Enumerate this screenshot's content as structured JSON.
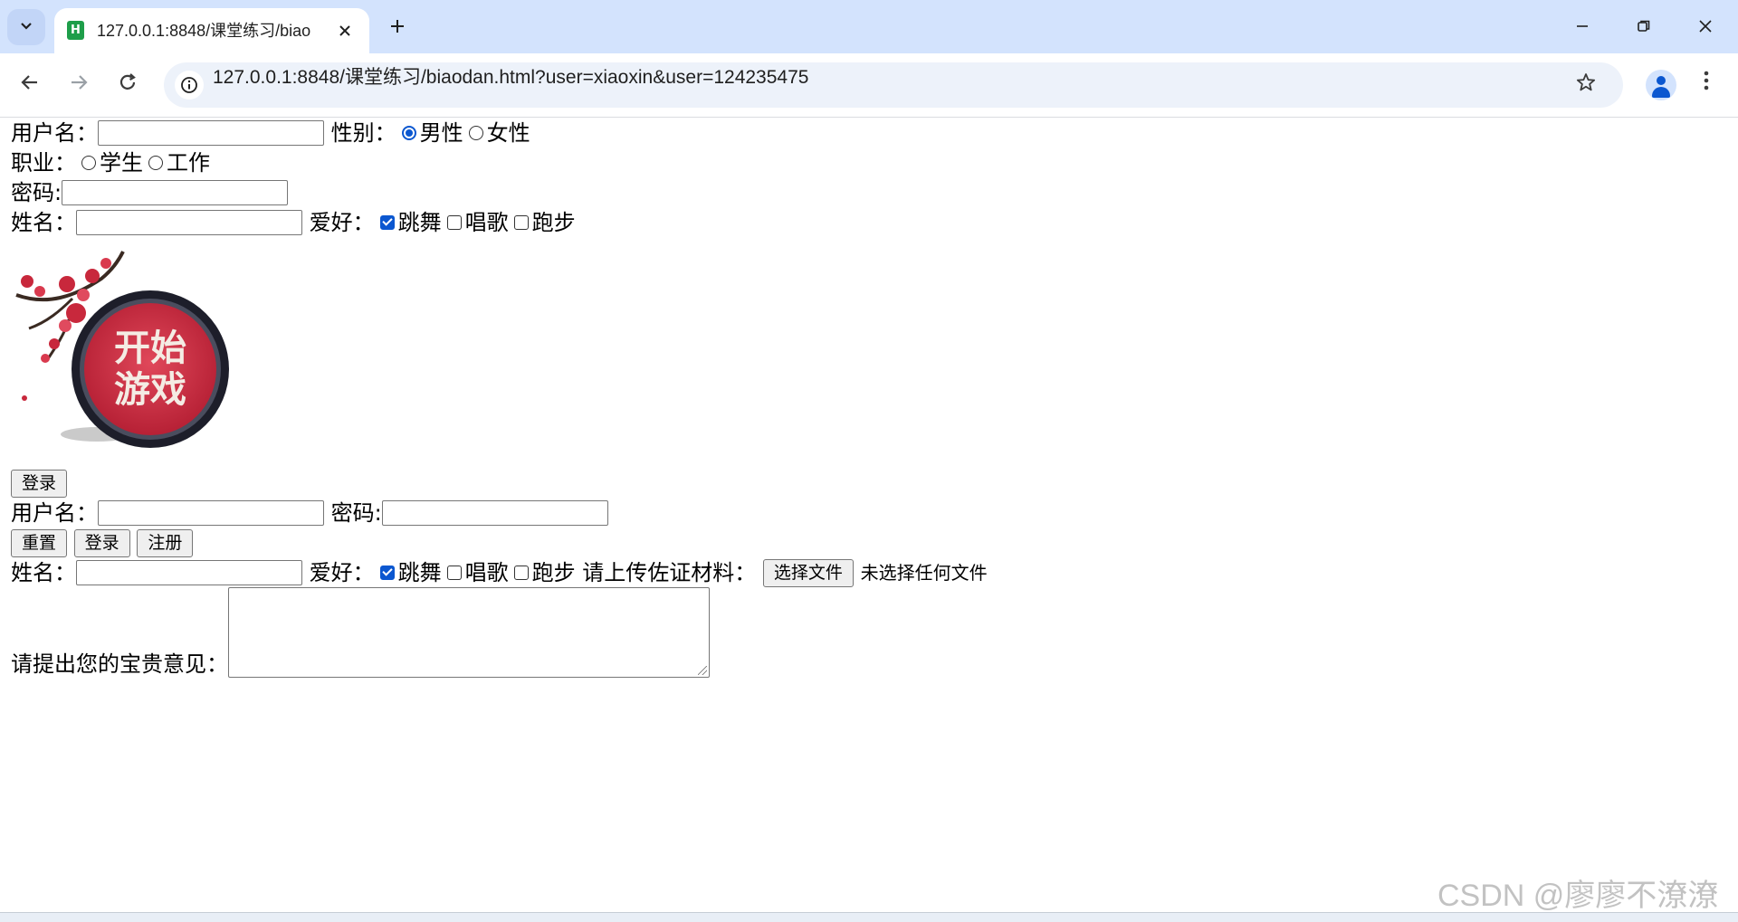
{
  "browser": {
    "tab": {
      "title": "127.0.0.1:8848/课堂练习/biao",
      "favicon": "H"
    },
    "url": "127.0.0.1:8848/课堂练习/biaodan.html?user=xiaoxin&user=124235475",
    "icons": {
      "tab_search": "chevron-down-icon",
      "close": "close-icon",
      "new_tab": "plus-icon",
      "back": "arrow-left-icon",
      "forward": "arrow-right-icon",
      "reload": "reload-icon",
      "site_info": "info-icon",
      "bookmark": "star-icon",
      "profile": "person-icon",
      "menu": "kebab-icon"
    }
  },
  "form": {
    "username_label": "用户名：",
    "gender_label": "性别：",
    "gender_options": [
      "男性",
      "女性"
    ],
    "gender_selected": "男性",
    "job_label": "职业：",
    "job_options": [
      "学生",
      "工作"
    ],
    "password_label": "密码:",
    "name_label": "姓名：",
    "hobby_label": "爱好：",
    "hobbies": [
      {
        "label": "跳舞",
        "checked": true
      },
      {
        "label": "唱歌",
        "checked": false
      },
      {
        "label": "跑步",
        "checked": false
      }
    ],
    "image_text_line1": "开始",
    "image_text_line2": "游戏",
    "login_button": "登录",
    "username2_label": "用户名：",
    "password2_label": "密码:",
    "reset_button": "重置",
    "login2_button": "登录",
    "register_button": "注册",
    "name2_label": "姓名：",
    "hobby2_label": "爱好：",
    "hobbies2": [
      {
        "label": "跳舞",
        "checked": true
      },
      {
        "label": "唱歌",
        "checked": false
      },
      {
        "label": "跑步",
        "checked": false
      }
    ],
    "upload_label": "请上传佐证材料：",
    "file_button": "选择文件",
    "file_status": "未选择任何文件",
    "feedback_label": "请提出您的宝贵意见："
  },
  "watermark": "CSDN @廖廖不潦潦",
  "colors": {
    "accent": "#0b57d0",
    "tabstrip": "#d3e3fd",
    "omnibox": "#edf2fa",
    "favicon": "#1e9e4a",
    "logo_red": "#c8283c"
  }
}
